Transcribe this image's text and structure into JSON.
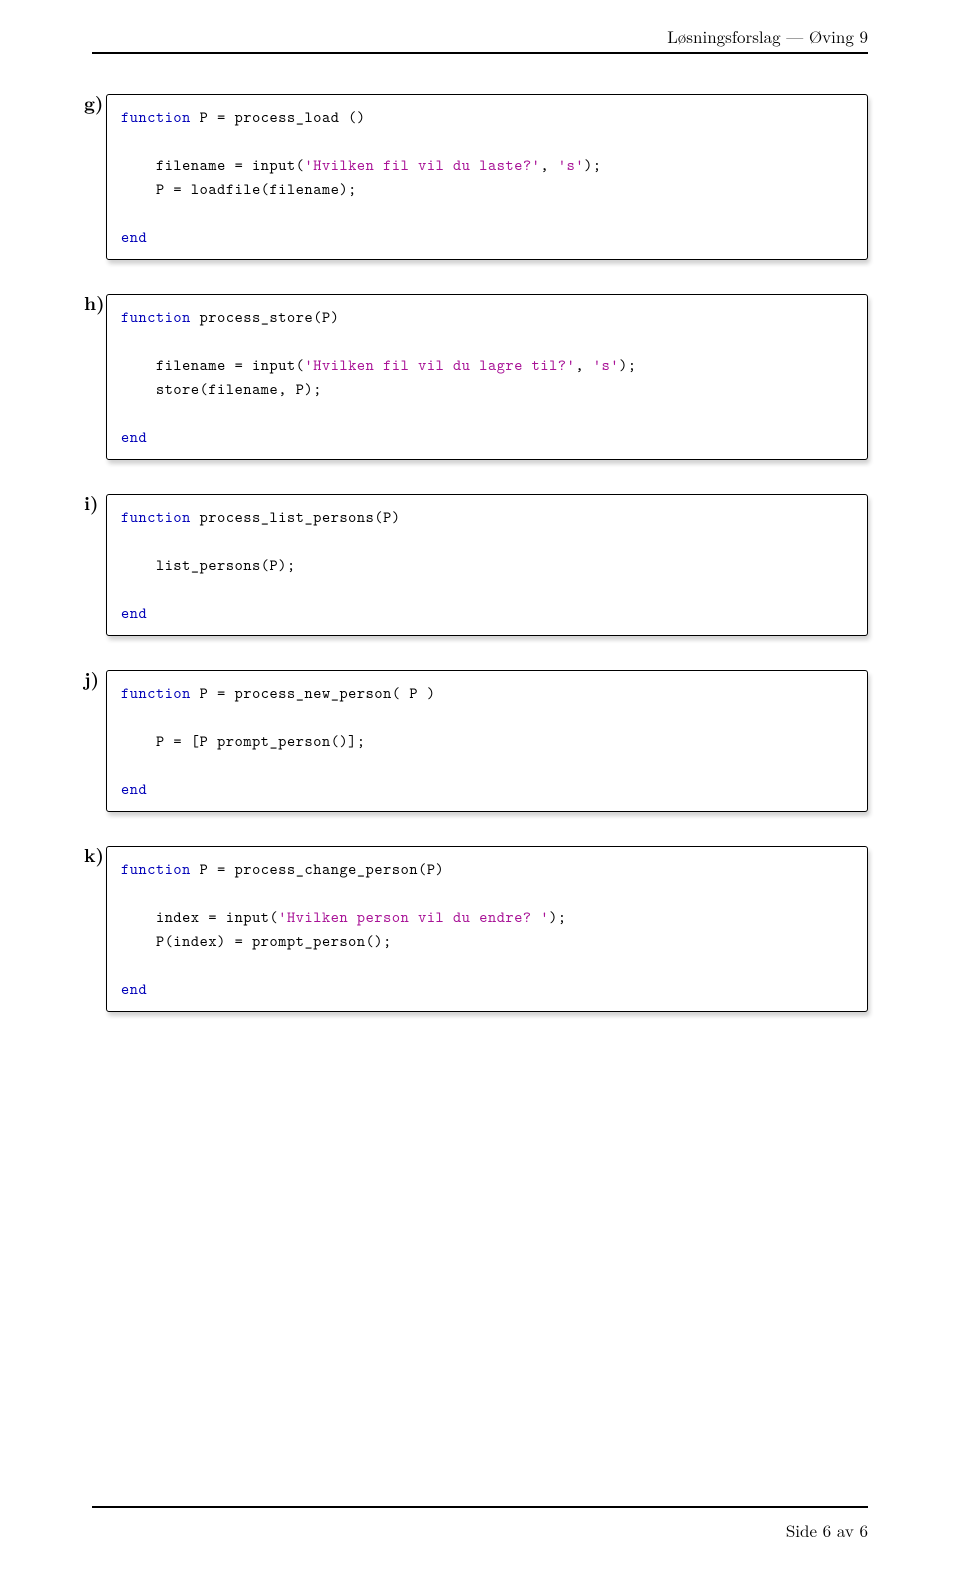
{
  "header": {
    "running": "Løsningsforslag — Øving 9"
  },
  "footer": {
    "text": "Side 6 av 6"
  },
  "blocks": [
    {
      "label": "g)",
      "code": [
        [
          {
            "t": "function",
            "c": "kw"
          },
          {
            "t": " P = process_load ()"
          }
        ],
        [],
        [
          {
            "t": "    filename = input("
          },
          {
            "t": "'Hvilken fil vil du laste?'",
            "c": "str"
          },
          {
            "t": ", "
          },
          {
            "t": "'s'",
            "c": "str"
          },
          {
            "t": ");"
          }
        ],
        [
          {
            "t": "    P = loadfile(filename);"
          }
        ],
        [],
        [
          {
            "t": "end",
            "c": "kw"
          }
        ]
      ]
    },
    {
      "label": "h)",
      "code": [
        [
          {
            "t": "function",
            "c": "kw"
          },
          {
            "t": " process_store(P)"
          }
        ],
        [],
        [
          {
            "t": "    filename = input("
          },
          {
            "t": "'Hvilken fil vil du lagre til?'",
            "c": "str"
          },
          {
            "t": ", "
          },
          {
            "t": "'s'",
            "c": "str"
          },
          {
            "t": ");"
          }
        ],
        [
          {
            "t": "    store(filename, P);"
          }
        ],
        [],
        [
          {
            "t": "end",
            "c": "kw"
          }
        ]
      ]
    },
    {
      "label": "i)",
      "code": [
        [
          {
            "t": "function",
            "c": "kw"
          },
          {
            "t": " process_list_persons(P)"
          }
        ],
        [],
        [
          {
            "t": "    list_persons(P);"
          }
        ],
        [],
        [
          {
            "t": "end",
            "c": "kw"
          }
        ]
      ]
    },
    {
      "label": "j)",
      "code": [
        [
          {
            "t": "function",
            "c": "kw"
          },
          {
            "t": " P = process_new_person( P )"
          }
        ],
        [],
        [
          {
            "t": "    P = [P prompt_person()];"
          }
        ],
        [],
        [
          {
            "t": "end",
            "c": "kw"
          }
        ]
      ]
    },
    {
      "label": "k)",
      "code": [
        [
          {
            "t": "function",
            "c": "kw"
          },
          {
            "t": " P = process_change_person(P)"
          }
        ],
        [],
        [
          {
            "t": "    index = input("
          },
          {
            "t": "'Hvilken person vil du endre? '",
            "c": "str"
          },
          {
            "t": ");"
          }
        ],
        [
          {
            "t": "    P(index) = prompt_person();"
          }
        ],
        [],
        [
          {
            "t": "end",
            "c": "kw"
          }
        ]
      ]
    }
  ]
}
